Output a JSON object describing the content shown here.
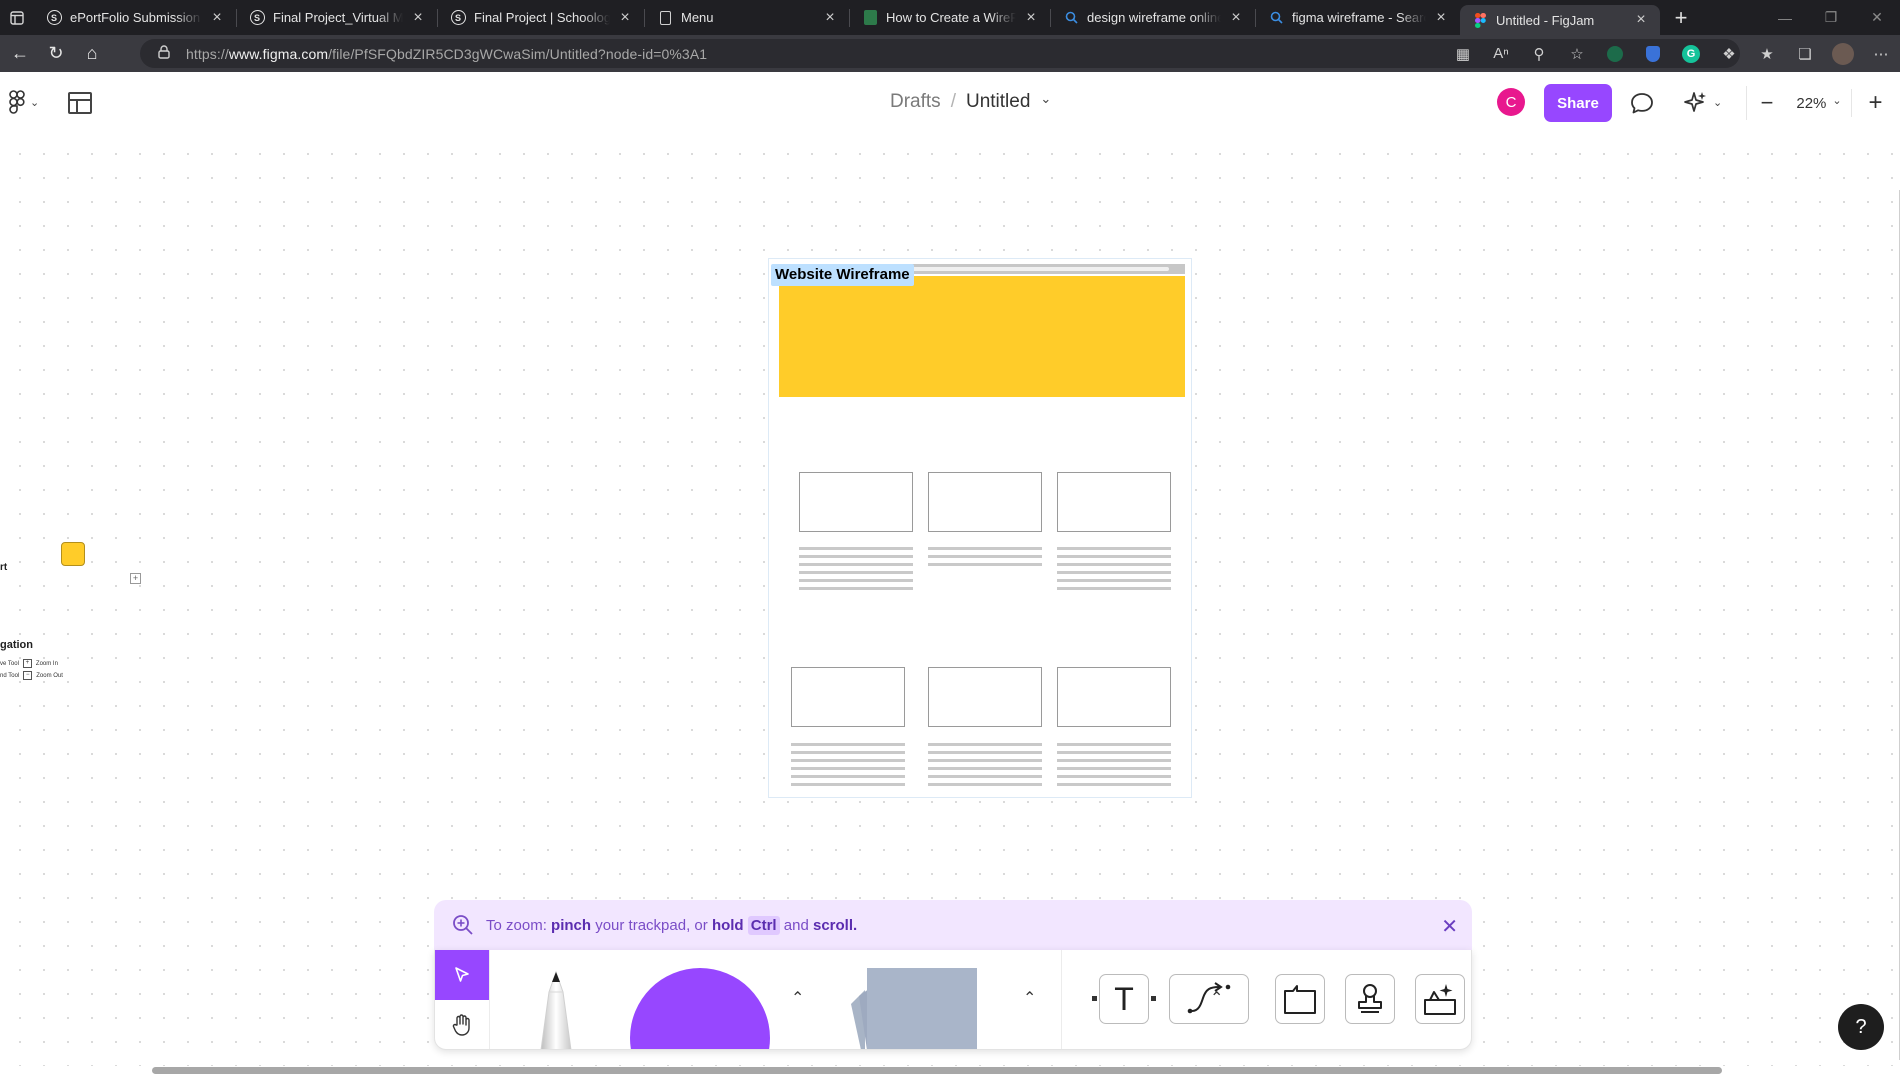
{
  "browser": {
    "tabs": [
      {
        "title": "ePortFolio Submission | Sc",
        "favicon": "schoology-icon",
        "active": false
      },
      {
        "title": "Final Project_Virtual Machi",
        "favicon": "schoology-icon",
        "active": false
      },
      {
        "title": "Final Project | Schoology",
        "favicon": "schoology-icon",
        "active": false
      },
      {
        "title": "Menu",
        "favicon": "page-icon",
        "active": false
      },
      {
        "title": "How to Create a WireFram",
        "favicon": "site-icon",
        "active": false
      },
      {
        "title": "design wireframe online fr",
        "favicon": "search-icon",
        "active": false
      },
      {
        "title": "figma wireframe - Search",
        "favicon": "search-icon",
        "active": false
      },
      {
        "title": "Untitled - FigJam",
        "favicon": "figma-icon",
        "active": true
      }
    ],
    "url_host": "www.figma.com",
    "url_prefix": "https://",
    "url_path": "/file/PfSFQbdZIR5CD3gWCwaSim/Untitled?node-id=0%3A1"
  },
  "figjam": {
    "breadcrumb": {
      "folder": "Drafts",
      "separator": "/",
      "file": "Untitled"
    },
    "avatar_initial": "C",
    "share_label": "Share",
    "zoom": "22%",
    "colors": {
      "accent": "#9747ff",
      "sticky": "#ffcc29",
      "avatar": "#e8188e",
      "frame_label_bg": "#bde0ff"
    }
  },
  "canvas": {
    "frame_label": "Website Wireframe",
    "fragments": {
      "t_label": "rt",
      "nav_label": "gation",
      "rows": [
        {
          "left": "ve Tool",
          "right": "Zoom In"
        },
        {
          "left": "nd Tool",
          "right": "Zoom Out"
        }
      ]
    }
  },
  "hint": {
    "prefix": "To zoom:",
    "bold1": "pinch",
    "mid": "your trackpad, or",
    "bold2": "hold",
    "kbd": "Ctrl",
    "and": "and",
    "bold3": "scroll."
  },
  "help_label": "?"
}
